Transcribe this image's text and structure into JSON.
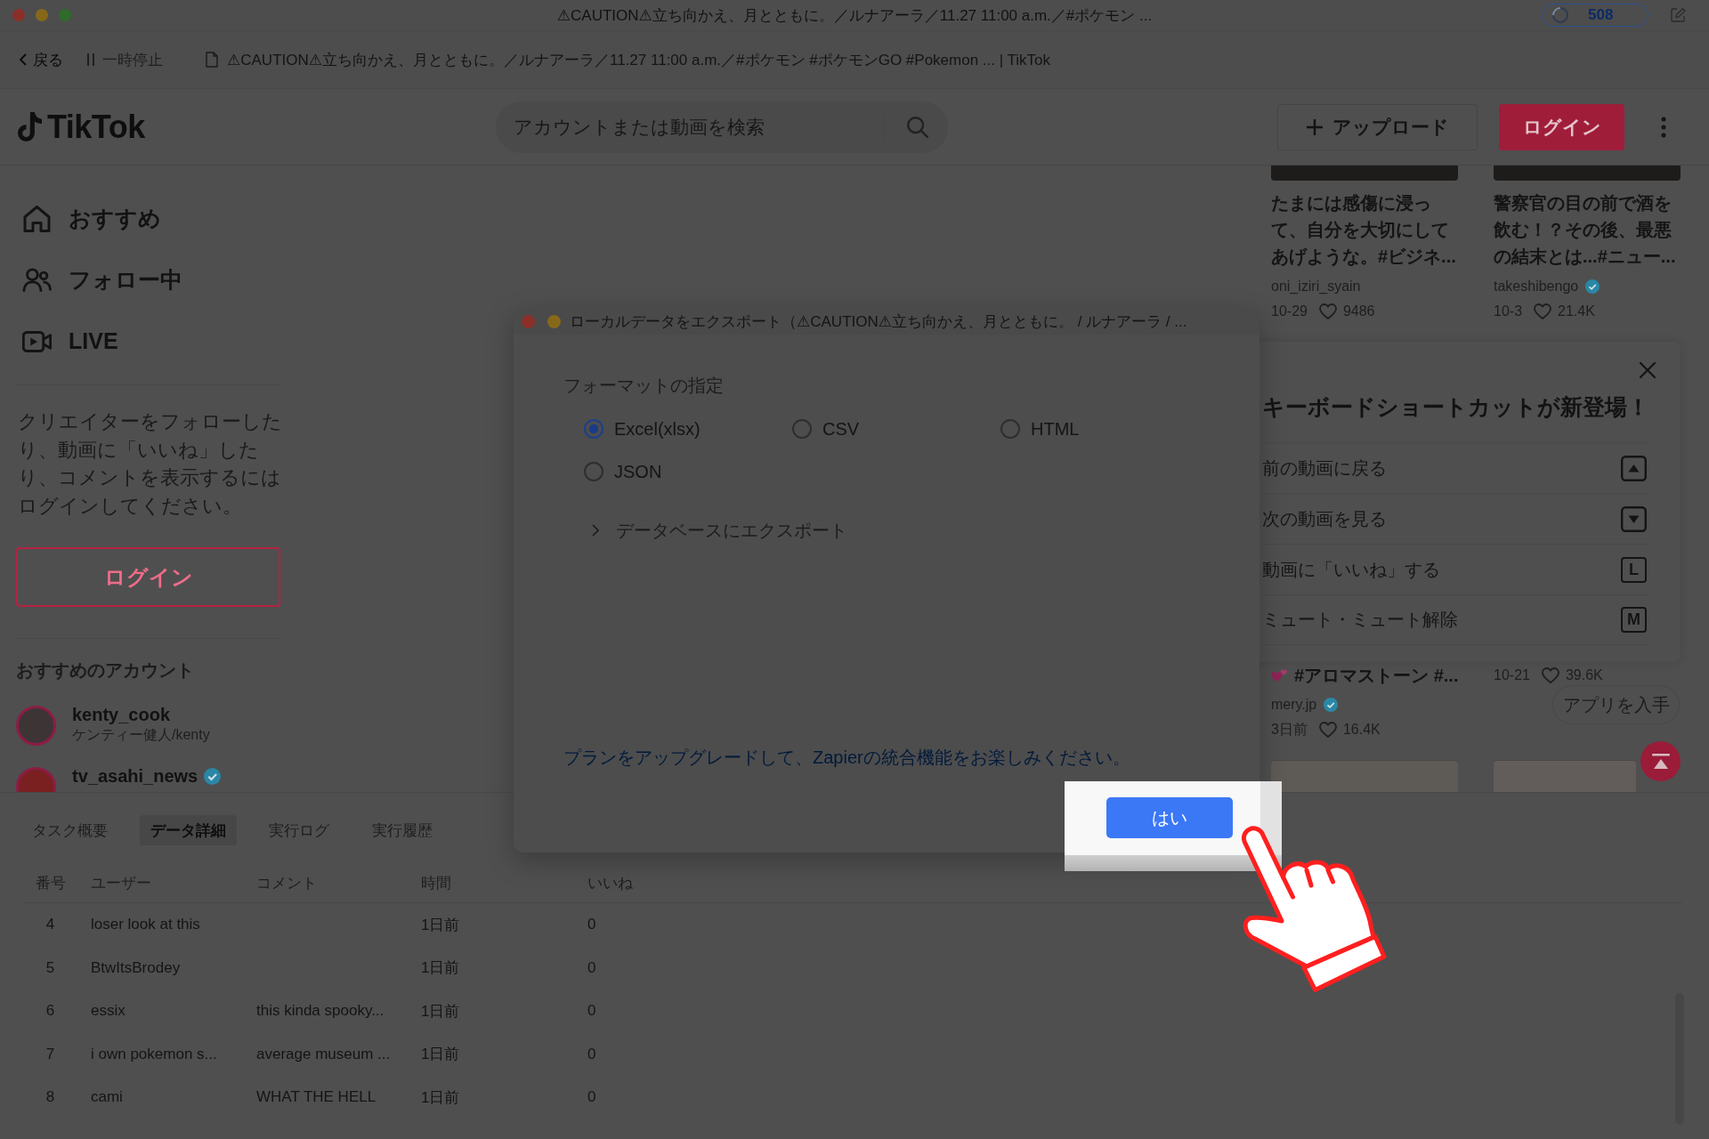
{
  "window": {
    "title": "⚠CAUTION⚠立ち向かえ、月とともに。／ルナアーラ／11.27 11:00 a.m.／#ポケモン ...",
    "counter": "508"
  },
  "nav_bar": {
    "back": "戻る",
    "pause": {
      "label": "一時停止",
      "disabled": true
    },
    "url": "⚠CAUTION⚠立ち向かえ、月とともに。／ルナアーラ／11.27 11:00 a.m.／#ポケモン #ポケモンGO #Pokemon ... | TikTok"
  },
  "header": {
    "logo": "TikTok",
    "search": {
      "placeholder": "アカウントまたは動画を検索"
    },
    "upload_button": "アップロード",
    "login_button": "ログイン"
  },
  "sidebar": {
    "nav_items": [
      {
        "kind": "home",
        "label": "おすすめ"
      },
      {
        "kind": "following",
        "label": "フォロー中"
      },
      {
        "kind": "live",
        "label": "LIVE"
      }
    ],
    "login_prompt": "クリエイターをフォローしたり、動画に「いいね」したり、コメントを表示するにはログインしてください。",
    "login_button": "ログイン",
    "accounts_heading": "おすすめのアカウント",
    "accounts": [
      {
        "username": "kenty_cook",
        "display_name": "ケンティー健人/kenty",
        "verified": false
      },
      {
        "username": "tv_asahi_news",
        "verified": true
      }
    ]
  },
  "feed": {
    "videos": [
      {
        "caption": "たまには感傷に浸って、自分を大切にしてあげような。#ビジネ...",
        "caption_icon": false,
        "author": "oni_iziri_syain",
        "verified": false,
        "date": "10-29",
        "likes": "9486"
      },
      {
        "caption": "警察官の目の前で酒を飲む！？その後、最悪の結末とは...#ニュー...",
        "caption_icon": false,
        "author": "takeshibengo",
        "verified": true,
        "date": "10-3",
        "likes": "21.4K"
      },
      {
        "caption": "#アロマストーン #...",
        "caption_icon": true,
        "author": "mery.jp",
        "verified": true,
        "date": "3日前",
        "likes": "16.4K"
      },
      {
        "date": "10-21",
        "likes": "39.6K"
      }
    ],
    "get_app_button": "アプリを入手"
  },
  "shortcuts_panel": {
    "title": "キーボードショートカットが新登場！",
    "items": [
      {
        "label": "前の動画に戻る",
        "kind": "up"
      },
      {
        "label": "次の動画を見る",
        "kind": "down"
      },
      {
        "label": "動画に「いいね」する",
        "kind": "letter",
        "key": "L"
      },
      {
        "label": "ミュート・ミュート解除",
        "kind": "letter",
        "key": "M"
      }
    ]
  },
  "export_dialog": {
    "title": "ローカルデータをエクスポート（⚠CAUTION⚠立ち向かえ、月とともに。 / ルナアーラ / ...",
    "format_label": "フォーマットの指定",
    "formats": [
      {
        "label": "Excel(xlsx)",
        "selected": true
      },
      {
        "label": "CSV",
        "selected": false
      },
      {
        "label": "HTML",
        "selected": false
      },
      {
        "label": "JSON",
        "selected": false
      }
    ],
    "database_export": {
      "label": "データベースにエクスポート",
      "expanded": false
    },
    "upgrade_link": "プランをアップグレードして、Zapierの統合機能をお楽しみください。",
    "confirm_button": "はい"
  },
  "bottom_panel": {
    "tabs": [
      {
        "label": "タスク概要",
        "selected": false
      },
      {
        "label": "データ詳細",
        "selected": true
      },
      {
        "label": "実行ログ",
        "selected": false
      },
      {
        "label": "実行履歴",
        "selected": false
      }
    ],
    "table": {
      "columns": [
        "番号",
        "ユーザー",
        "コメント",
        "時間",
        "いいね"
      ],
      "rows": [
        {
          "number": "4",
          "user": "loser look at this",
          "time": "1日前",
          "likes": "0"
        },
        {
          "number": "5",
          "user": "BtwItsBrodey",
          "time": "1日前",
          "likes": "0"
        },
        {
          "number": "6",
          "user": "essix",
          "comment": "this kinda spooky...",
          "time": "1日前",
          "likes": "0"
        },
        {
          "number": "7",
          "user": "i own pokemon s...",
          "comment": "average museum ...",
          "time": "1日前",
          "likes": "0"
        },
        {
          "number": "8",
          "user": "cami",
          "comment": "WHAT THE HELL",
          "time": "1日前",
          "likes": "0"
        }
      ]
    }
  }
}
